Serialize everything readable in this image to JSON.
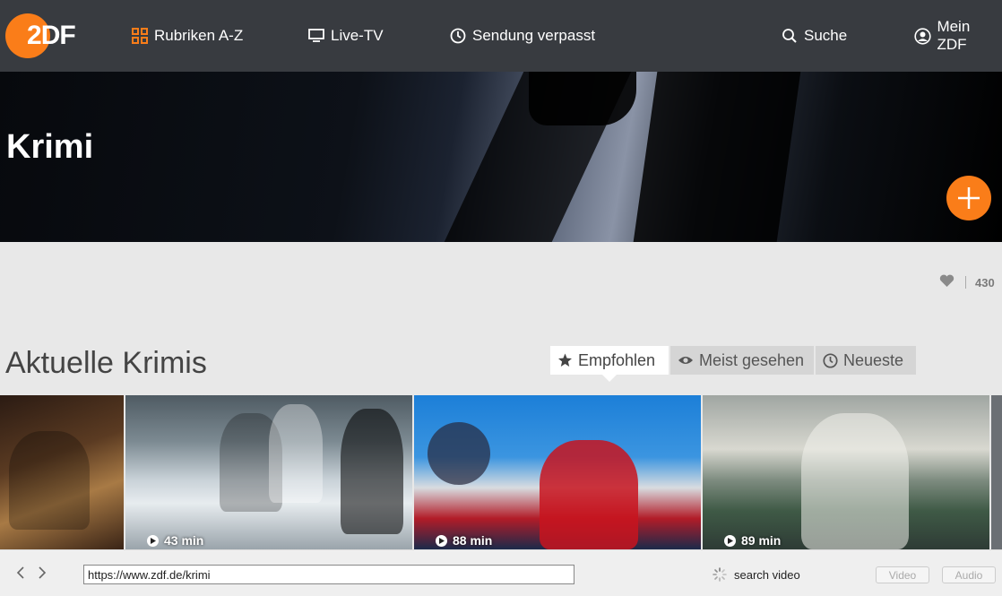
{
  "header": {
    "logo": {
      "part1": "2",
      "part2": "DF",
      "accent": "#fa7d19"
    },
    "nav": [
      {
        "label": "Rubriken A-Z",
        "icon": "grid-icon"
      },
      {
        "label": "Live-TV",
        "icon": "tv-icon"
      },
      {
        "label": "Sendung verpasst",
        "icon": "clock-icon"
      },
      {
        "label": "Suche",
        "icon": "search-icon"
      },
      {
        "label": "Mein ZDF",
        "icon": "user-icon"
      }
    ]
  },
  "hero": {
    "title": "Krimi"
  },
  "likes": {
    "count": "430"
  },
  "section": {
    "title": "Aktuelle Krimis",
    "tabs": [
      {
        "label": "Empfohlen",
        "icon": "star-icon",
        "active": true
      },
      {
        "label": "Meist gesehen",
        "icon": "eye-icon",
        "active": false
      },
      {
        "label": "Neueste",
        "icon": "clock-icon",
        "active": false
      }
    ]
  },
  "teasers": [
    {
      "duration": ""
    },
    {
      "duration": "43 min"
    },
    {
      "duration": "88 min"
    },
    {
      "duration": "89 min"
    }
  ],
  "browser": {
    "url": "https://www.zdf.de/krimi",
    "status": "search video",
    "video_label": "Video",
    "audio_label": "Audio"
  }
}
